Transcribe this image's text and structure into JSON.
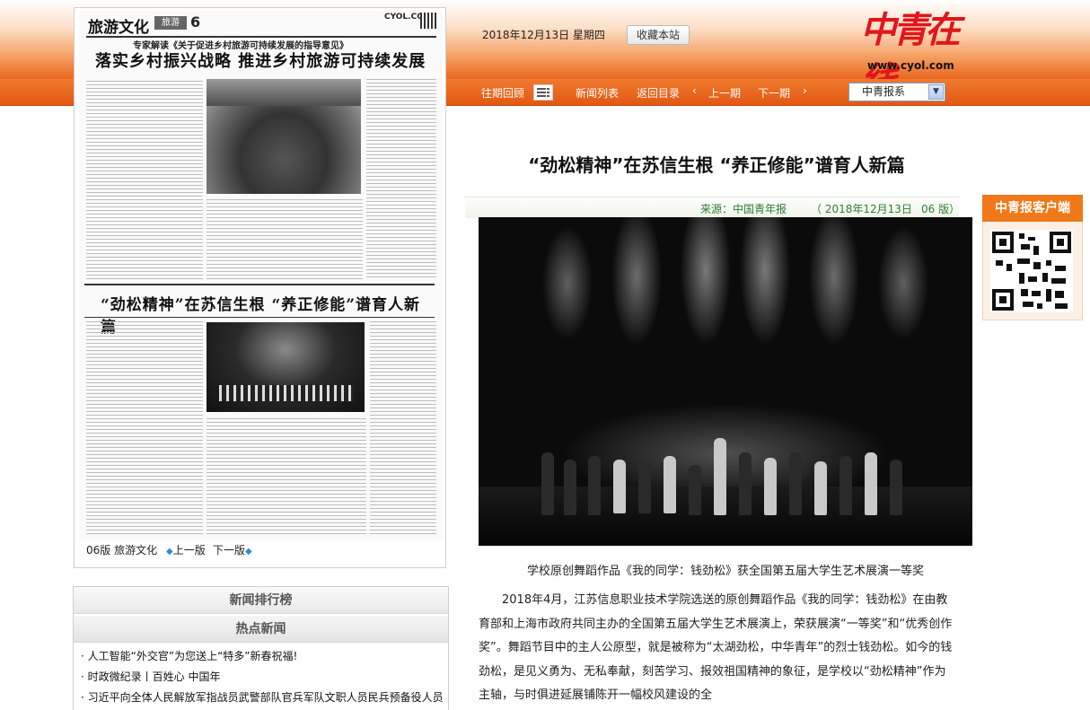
{
  "header": {
    "date": "2018年12月13日 星期四",
    "bookmark_label": "收藏本站",
    "logo_text": "中青在线",
    "logo_url": "www.cyol.com"
  },
  "nav": {
    "past_review": "往期回顾",
    "news_list": "新闻列表",
    "back_to_index": "返回目录",
    "prev_issue": "上一期",
    "next_issue": "下一期",
    "paper_select": "中青报系"
  },
  "paper_page": {
    "section": "旅游文化",
    "badge": "旅游",
    "page_num": "6",
    "site": "CYOL.COM",
    "kicker": "专家解读《关于促进乡村旅游可持续发展的指导意见》",
    "headline": "落实乡村振兴战略  推进乡村旅游可持续发展",
    "sub_headline": "“劲松精神”在苏信生根 “养正修能”谱育人新篇",
    "pager_label": "06版 旅游文化",
    "prev_page": "上一版",
    "next_page": "下一版"
  },
  "ranking": {
    "title": "新闻排行榜",
    "subtitle": "热点新闻",
    "items": [
      "· 人工智能“外交官”为您送上“特多”新春祝福!",
      "· 时政微纪录丨百姓心  中国年",
      "· 习近平向全体人民解放军指战员武警部队官兵军队文职人员民兵预备役人员"
    ]
  },
  "article": {
    "title": "“劲松精神”在苏信生根  “养正修能”谱育人新篇",
    "source": "来源：中国青年报",
    "date": "（  2018年12月13日",
    "page": "06  版）",
    "caption": "学校原创舞蹈作品《我的同学：钱劲松》获全国第五届大学生艺术展演一等奖",
    "body": "2018年4月，江苏信息职业技术学院选送的原创舞蹈作品《我的同学：钱劲松》在由教育部和上海市政府共同主办的全国第五届大学生艺术展演上，荣获展演“一等奖”和“优秀创作奖”。舞蹈节目中的主人公原型，就是被称为“太湖劲松，中华青年”的烈士钱劲松。如今的钱劲松，是见义勇为、无私奉献，刻苦学习、报效祖国精神的象征，是学校以“劲松精神”作为主轴，与时俱进延展铺陈开一幅校风建设的全"
  },
  "client": {
    "title": "中青报客户端"
  }
}
